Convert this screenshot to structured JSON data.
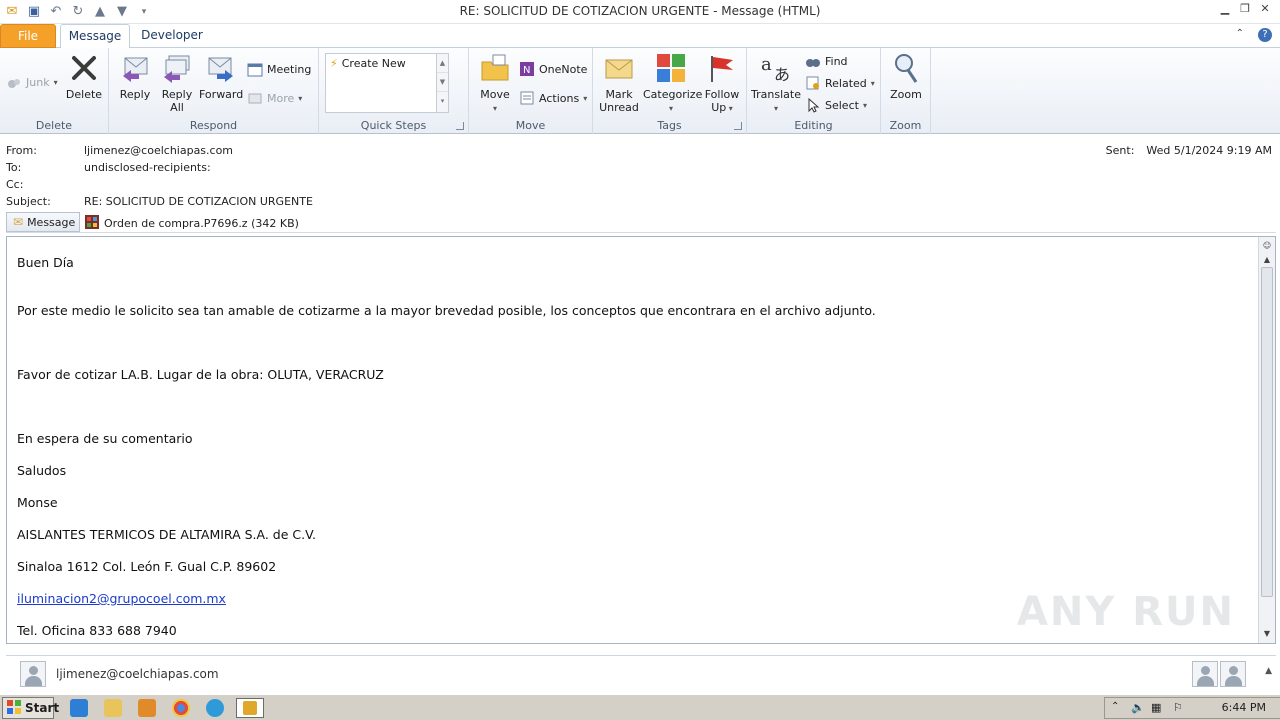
{
  "window": {
    "title": "RE: SOLICITUD DE COTIZACION URGENTE  -  Message (HTML)"
  },
  "tabs": [
    {
      "label": "File"
    },
    {
      "label": "Message"
    },
    {
      "label": "Developer"
    }
  ],
  "ribbon": {
    "groups": {
      "delete": "Delete",
      "respond": "Respond",
      "quick_steps": "Quick Steps",
      "move": "Move",
      "tags": "Tags",
      "editing": "Editing",
      "zoom": "Zoom"
    },
    "buttons": {
      "junk": "Junk",
      "delete": "Delete",
      "reply": "Reply",
      "reply_all_1": "Reply",
      "reply_all_2": "All",
      "forward": "Forward",
      "meeting": "Meeting",
      "more": "More",
      "create_new": "Create New",
      "move": "Move",
      "onenote": "OneNote",
      "actions": "Actions",
      "mark_unread_1": "Mark",
      "mark_unread_2": "Unread",
      "categorize": "Categorize",
      "follow_up_1": "Follow",
      "follow_up_2": "Up",
      "translate": "Translate",
      "find": "Find",
      "related": "Related",
      "select": "Select",
      "zoom": "Zoom"
    }
  },
  "header": {
    "from_label": "From:",
    "from": "ljimenez@coelchiapas.com",
    "to_label": "To:",
    "to": "undisclosed-recipients:",
    "cc_label": "Cc:",
    "cc": "",
    "subject_label": "Subject:",
    "subject": "RE: SOLICITUD DE COTIZACION URGENTE",
    "sent_label": "Sent:",
    "sent": "Wed 5/1/2024 9:19 AM"
  },
  "attachments": {
    "message_tab": "Message",
    "file": "Orden de compra.P7696.z (342 KB)"
  },
  "body": {
    "greeting": "Buen Día",
    "line1": "Por este medio le solicito sea tan amable de cotizarme a la mayor brevedad posible, los conceptos que encontrara en el archivo adjunto.",
    "line2": "Favor de cotizar LA.B. Lugar de la obra: OLUTA, VERACRUZ",
    "line3": "En espera de su comentario",
    "line4": "Saludos",
    "line5": "Monse",
    "line6": "AISLANTES TERMICOS DE ALTAMIRA S.A. de C.V.",
    "line7": "Sinaloa 1612 Col. León F. Gual C.P. 89602",
    "email_link": "iluminacion2@grupocoel.com.mx",
    "line8": "Tel. Oficina 833 688 7940"
  },
  "people_pane": {
    "name": "ljimenez@coelchiapas.com"
  },
  "taskbar": {
    "start": "Start",
    "clock": "6:44 PM"
  },
  "watermark": "ANY RUN"
}
